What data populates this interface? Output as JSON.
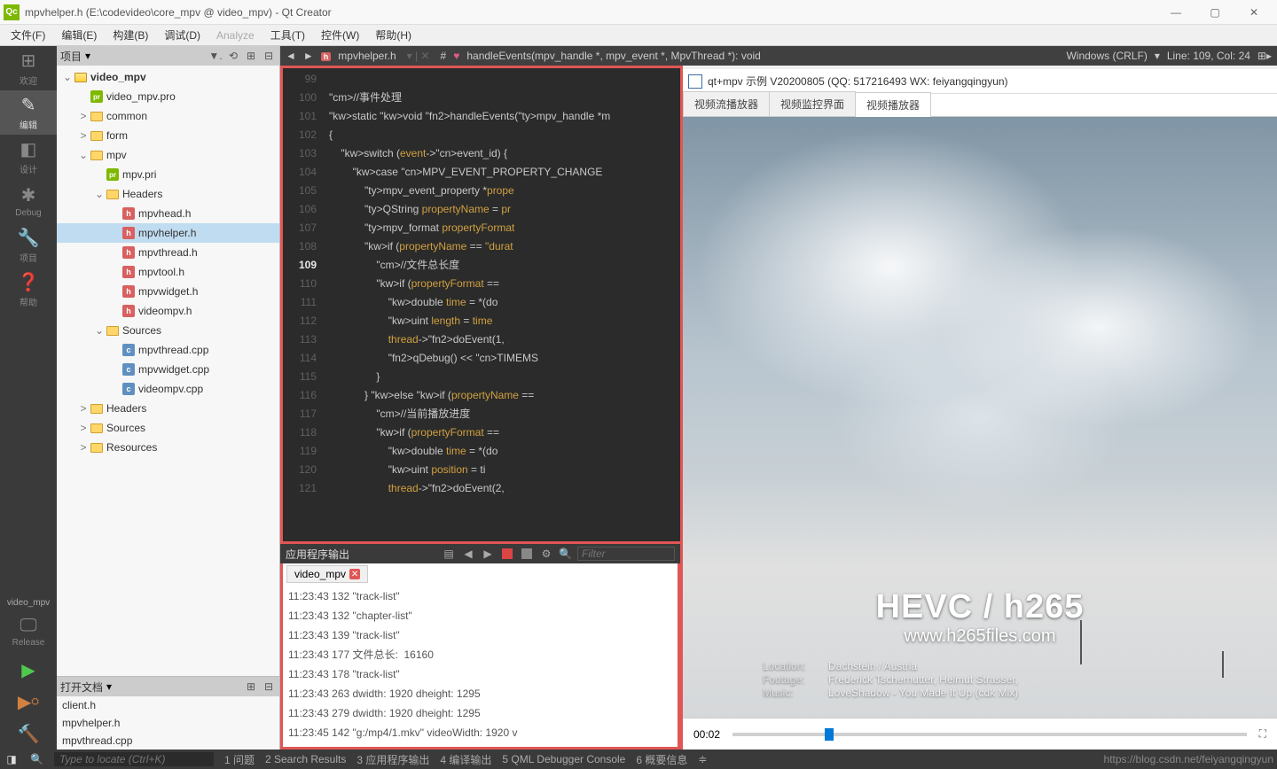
{
  "window": {
    "title": "mpvhelper.h (E:\\codevideo\\core_mpv @ video_mpv) - Qt Creator",
    "min": "—",
    "max": "▢",
    "close": "✕"
  },
  "menu": [
    "文件(F)",
    "编辑(E)",
    "构建(B)",
    "调试(D)",
    "Analyze",
    "工具(T)",
    "控件(W)",
    "帮助(H)"
  ],
  "iconbar": {
    "items": [
      {
        "glyph": "⊞",
        "lbl": "欢迎"
      },
      {
        "glyph": "✎",
        "lbl": "编辑",
        "sel": true
      },
      {
        "glyph": "✧",
        "lbl": "设计"
      },
      {
        "glyph": "✱",
        "lbl": "Debug"
      },
      {
        "glyph": "🔧",
        "lbl": "项目"
      },
      {
        "glyph": "❓",
        "lbl": "帮助"
      }
    ],
    "target1": "video_mpv",
    "target2": "Release"
  },
  "projhdr": {
    "title": "项目"
  },
  "tree": [
    {
      "ind": 0,
      "exp": "⌄",
      "ico": "proj",
      "t": "video_mpv",
      "b": true
    },
    {
      "ind": 1,
      "exp": "",
      "ico": "p",
      "t": "video_mpv.pro"
    },
    {
      "ind": 1,
      "exp": ">",
      "ico": "folder",
      "t": "common"
    },
    {
      "ind": 1,
      "exp": ">",
      "ico": "folder",
      "t": "form"
    },
    {
      "ind": 1,
      "exp": "⌄",
      "ico": "folder",
      "t": "mpv"
    },
    {
      "ind": 2,
      "exp": "",
      "ico": "p",
      "t": "mpv.pri"
    },
    {
      "ind": 2,
      "exp": "⌄",
      "ico": "folder",
      "t": "Headers"
    },
    {
      "ind": 3,
      "exp": "",
      "ico": "h",
      "t": "mpvhead.h"
    },
    {
      "ind": 3,
      "exp": "",
      "ico": "h",
      "t": "mpvhelper.h",
      "sel": true
    },
    {
      "ind": 3,
      "exp": "",
      "ico": "h",
      "t": "mpvthread.h"
    },
    {
      "ind": 3,
      "exp": "",
      "ico": "h",
      "t": "mpvtool.h"
    },
    {
      "ind": 3,
      "exp": "",
      "ico": "h",
      "t": "mpvwidget.h"
    },
    {
      "ind": 3,
      "exp": "",
      "ico": "h",
      "t": "videompv.h"
    },
    {
      "ind": 2,
      "exp": "⌄",
      "ico": "folder",
      "t": "Sources"
    },
    {
      "ind": 3,
      "exp": "",
      "ico": "c",
      "t": "mpvthread.cpp"
    },
    {
      "ind": 3,
      "exp": "",
      "ico": "c",
      "t": "mpvwidget.cpp"
    },
    {
      "ind": 3,
      "exp": "",
      "ico": "c",
      "t": "videompv.cpp"
    },
    {
      "ind": 1,
      "exp": ">",
      "ico": "folder",
      "t": "Headers"
    },
    {
      "ind": 1,
      "exp": ">",
      "ico": "folder",
      "t": "Sources"
    },
    {
      "ind": 1,
      "exp": ">",
      "ico": "folder",
      "t": "Resources"
    }
  ],
  "openhdr": {
    "title": "打开文档"
  },
  "openfiles": [
    "client.h",
    "mpvhelper.h",
    "mpvthread.cpp"
  ],
  "tab": {
    "file": "mpvhelper.h"
  },
  "ctx": {
    "sym": "handleEvents(mpv_handle *, mpv_event *, MpvThread *): void",
    "enc": "Windows (CRLF)",
    "pos": "Line: 109, Col: 24"
  },
  "code": {
    "start": 99,
    "cur": 109,
    "lines": [
      "",
      "//事件处理",
      "static void handleEvents(mpv_handle *m",
      "{",
      "    switch (event->event_id) {",
      "        case MPV_EVENT_PROPERTY_CHANGE",
      "            mpv_event_property *prope",
      "            QString propertyName = pr",
      "            mpv_format propertyFormat ",
      "            if (propertyName == \"durat",
      "                //文件总长度",
      "                if (propertyFormat == ",
      "                    double time = *(do",
      "                    uint length = time",
      "                    thread->doEvent(1,",
      "                    qDebug() << TIMEMS",
      "                }",
      "            } else if (propertyName ==",
      "                //当前播放进度",
      "                if (propertyFormat == ",
      "                    double time = *(do",
      "                    uint position = ti",
      "                    thread->doEvent(2,"
    ]
  },
  "outbar": {
    "title": "应用程序输出",
    "filter": "Filter"
  },
  "out": {
    "tab": "video_mpv",
    "lines": [
      "11:23:43 132 \"track-list\"",
      "11:23:43 132 \"chapter-list\"",
      "11:23:43 139 \"track-list\"",
      "11:23:43 177 文件总长:  16160",
      "11:23:43 178 \"track-list\"",
      "11:23:43 263 dwidth: 1920 dheight: 1295",
      "11:23:43 279 dwidth: 1920 dheight: 1295",
      "11:23:45 142 \"g:/mp4/1.mkv\" videoWidth: 1920 v"
    ]
  },
  "app": {
    "title": "qt+mpv 示例 V20200805 (QQ: 517216493 WX: feiyangqingyun)",
    "tabs": [
      "视频流播放器",
      "视频监控界面",
      "视频播放器"
    ],
    "sel": 2,
    "ov1": "HEVC / h265",
    "ov2": "www.h265files.com",
    "credits": [
      {
        "k": "Location:",
        "v": "Dachstein / Austria"
      },
      {
        "k": "Footage:",
        "v": "Frederick Tschernutter, Helmut Strasser,"
      },
      {
        "k": "Music:",
        "v": "LoveShadow - You Made It Up (cdk Mix)"
      }
    ],
    "time": "00:02"
  },
  "status": {
    "locate": "Type to locate (Ctrl+K)",
    "tabs": [
      "1 问题",
      "2 Search Results",
      "3 应用程序输出",
      "4 编译输出",
      "5 QML Debugger Console",
      "6 概要信息"
    ],
    "wm": "https://blog.csdn.net/feiyangqingyun"
  }
}
